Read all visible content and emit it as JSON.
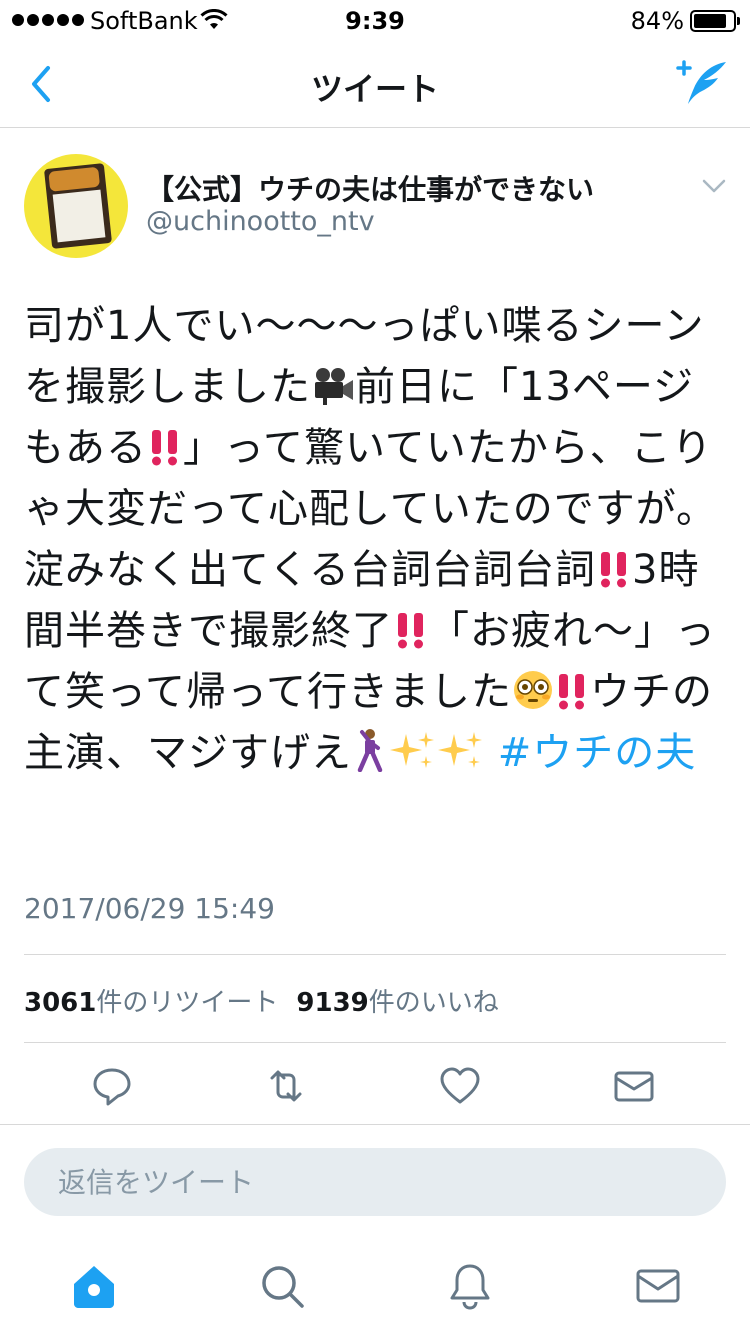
{
  "status_bar": {
    "carrier": "SoftBank",
    "time": "9:39",
    "battery_percent_label": "84%",
    "battery_level": 0.84
  },
  "nav": {
    "title": "ツイート",
    "back_icon": "chevron-left-icon",
    "compose_icon": "compose-tweet-icon"
  },
  "tweet": {
    "display_name": "【公式】ウチの夫は仕事ができない",
    "handle": "@uchinootto_ntv",
    "text_parts": {
      "p1": "司が1人でい〜〜〜っぱい喋るシーンを撮影しました",
      "p2": "前日に「13ページもある",
      "p3": "」って驚いていたから、こりゃ大変だって心配していたのですが。淀みなく出てくる台詞台詞台詞",
      "p4": "3時間半巻きで撮影終了",
      "p5": "「お疲れ〜」って笑って帰って行きました",
      "p6": "ウチの主演、マジすげえ",
      "hashtag": "#ウチの夫"
    },
    "timestamp": "2017/06/29 15:49",
    "retweet_count": "3061",
    "retweet_label": "件のリツイート",
    "like_count": "9139",
    "like_label": "件のいいね"
  },
  "actions": [
    "reply-icon",
    "retweet-icon",
    "like-icon",
    "direct-message-icon"
  ],
  "reply": {
    "placeholder": "返信をツイート"
  },
  "tab_bar": [
    "home-icon",
    "search-icon",
    "notifications-icon",
    "messages-icon"
  ],
  "colors": {
    "accent": "#1da1f2",
    "icon_gray": "#657786",
    "emphasis_red": "#e0245e"
  }
}
